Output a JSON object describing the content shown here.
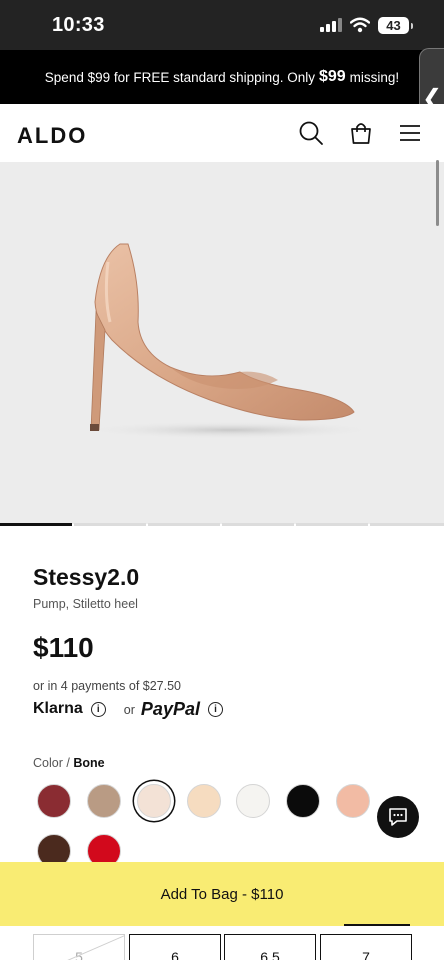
{
  "status": {
    "time": "10:33",
    "battery": "43"
  },
  "promo": {
    "prefix": "Spend $99 for FREE standard shipping. Only",
    "amount": "$99",
    "suffix": "missing!"
  },
  "header": {
    "logo": "ALDO",
    "icons": [
      "search-icon",
      "bag-icon",
      "menu-icon"
    ]
  },
  "product": {
    "name": "Stessy2.0",
    "subtitle": "Pump, Stiletto heel",
    "price": "$110",
    "installments": "or in 4 payments of $27.50",
    "klarna": "Klarna",
    "or": "or",
    "paypal": "PayPal",
    "info_glyph": "i"
  },
  "carousel": {
    "slides": 6,
    "active_index": 0
  },
  "color": {
    "label": "Color",
    "separator": "/",
    "selected": "Bone",
    "swatches": [
      {
        "color": "#8a2c32"
      },
      {
        "color": "#b99b84"
      },
      {
        "color": "#f3e2d6",
        "selected": true
      },
      {
        "color": "#f6dcc0"
      },
      {
        "color": "#f5f4f1"
      },
      {
        "color": "#0b0b0b"
      },
      {
        "color": "#f2bba4"
      },
      {
        "color": "#4b2a1e"
      },
      {
        "color": "#d2091c"
      }
    ]
  },
  "sizes": [
    "5",
    "6",
    "6.5",
    "7"
  ],
  "cta": {
    "label": "Add To Bag - $110"
  },
  "colors": {
    "cta_bg": "#f9ec73",
    "promo_bg": "#000000",
    "status_bg": "#232323"
  }
}
